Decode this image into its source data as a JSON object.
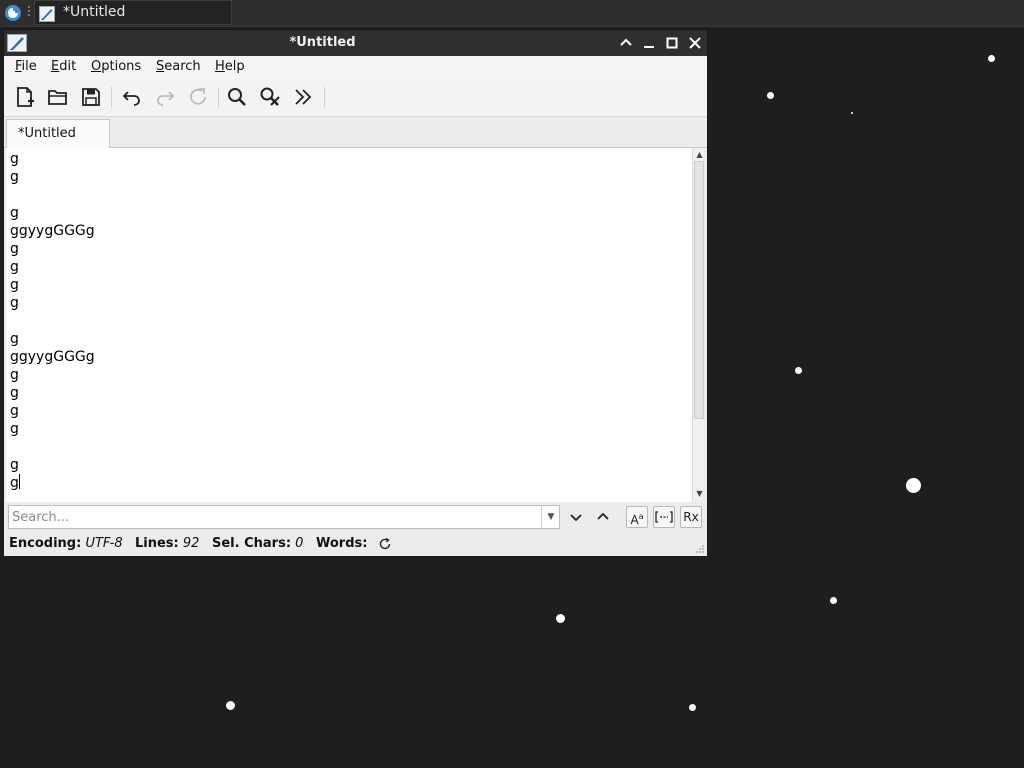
{
  "taskbar": {
    "task_title": "*Untitled"
  },
  "window": {
    "title": "*Untitled"
  },
  "menu": {
    "items": [
      {
        "label": "File",
        "accel": "F",
        "rest": "ile"
      },
      {
        "label": "Edit",
        "accel": "E",
        "rest": "dit"
      },
      {
        "label": "Options",
        "accel": "O",
        "rest": "ptions"
      },
      {
        "label": "Search",
        "accel": "S",
        "rest": "earch"
      },
      {
        "label": "Help",
        "accel": "H",
        "rest": "elp"
      }
    ]
  },
  "toolbar": {
    "icons": [
      "new-document-icon",
      "open-folder-icon",
      "save-icon",
      "undo-icon",
      "redo-icon",
      "reload-icon",
      "find-icon",
      "find-replace-icon",
      "more-icon"
    ]
  },
  "tabs": [
    {
      "label": "*Untitled"
    }
  ],
  "editor": {
    "lines": [
      "g",
      "g",
      "",
      "g",
      "ggyygGGGg",
      "g",
      "g",
      "g",
      "g",
      "",
      "g",
      "ggyygGGGg",
      "g",
      "g",
      "g",
      "g",
      "",
      "g",
      "g"
    ]
  },
  "search": {
    "placeholder": "Search...",
    "value": "",
    "case_label": "A",
    "case_sup": "a",
    "regex_label": "Rx"
  },
  "status": {
    "encoding_label": "Encoding:",
    "encoding_value": "UTF-8",
    "lines_label": "Lines:",
    "lines_value": "92",
    "sel_label": "Sel. Chars:",
    "sel_value": "0",
    "words_label": "Words:"
  },
  "colors": {
    "desktop": "#1f1e1f",
    "titlebar": "#2f2f2f",
    "window_bg": "#ececec"
  }
}
